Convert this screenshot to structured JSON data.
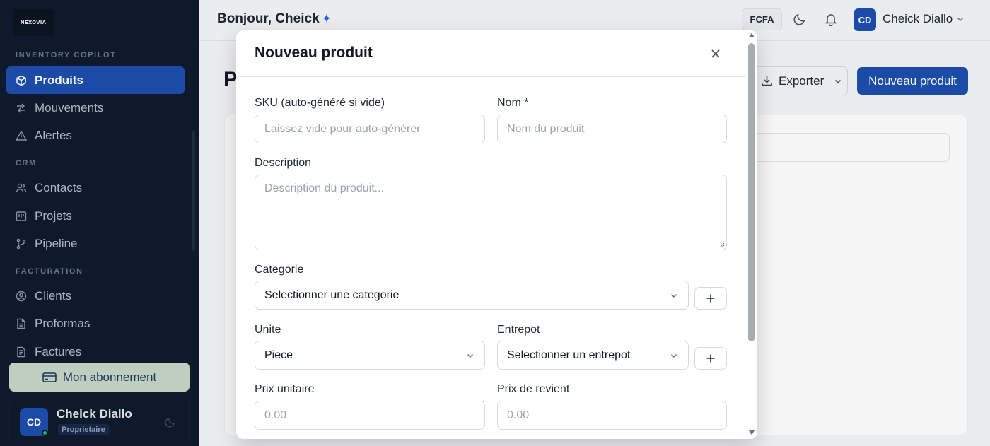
{
  "sidebar": {
    "logo_text": "NEXOVIA",
    "sections": {
      "inventory": "INVENTORY COPILOT",
      "crm": "CRM",
      "billing": "FACTURATION"
    },
    "items": {
      "products": "Produits",
      "movements": "Mouvements",
      "alerts": "Alertes",
      "contacts": "Contacts",
      "projects": "Projets",
      "pipeline": "Pipeline",
      "clients": "Clients",
      "proformas": "Proformas",
      "invoices": "Factures"
    },
    "subscription_label": "Mon abonnement",
    "user": {
      "initials": "CD",
      "name": "Cheick Diallo",
      "role": "Proprietaire"
    }
  },
  "header": {
    "greeting": "Bonjour, Cheick",
    "greeting_icon": "sparkle-icon",
    "currency": "FCFA",
    "user_initials": "CD",
    "user_name": "Cheick Diallo"
  },
  "page": {
    "title_fragment": "P",
    "export_label": "Exporter",
    "new_product_label": "Nouveau produit"
  },
  "modal": {
    "title": "Nouveau produit",
    "fields": {
      "sku": {
        "label": "SKU (auto-généré si vide)",
        "placeholder": "Laissez vide pour auto-générer"
      },
      "name": {
        "label": "Nom *",
        "placeholder": "Nom du produit"
      },
      "description": {
        "label": "Description",
        "placeholder": "Description du produit..."
      },
      "category": {
        "label": "Categorie",
        "value": "Selectionner une categorie"
      },
      "unit": {
        "label": "Unite",
        "value": "Piece"
      },
      "warehouse": {
        "label": "Entrepot",
        "value": "Selectionner un entrepot"
      },
      "unit_price": {
        "label": "Prix unitaire",
        "placeholder": "0.00"
      },
      "cost_price": {
        "label": "Prix de revient",
        "placeholder": "0.00"
      }
    }
  },
  "colors": {
    "sidebar_bg": "#0f1b2d",
    "primary": "#1d4fae",
    "subscription_bg": "#c8d7c8",
    "online": "#22c55e"
  }
}
